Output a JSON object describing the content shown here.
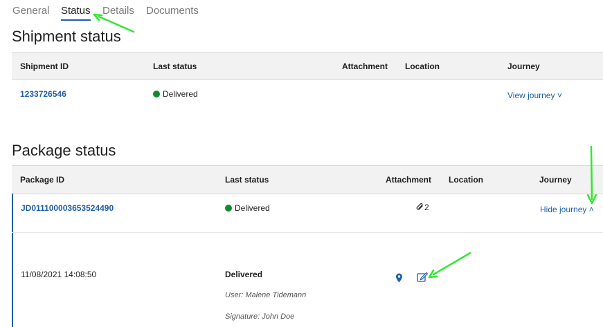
{
  "tabs": [
    {
      "label": "General"
    },
    {
      "label": "Status"
    },
    {
      "label": "Details"
    },
    {
      "label": "Documents"
    }
  ],
  "shipment": {
    "title": "Shipment status",
    "columns": [
      "Shipment ID",
      "Last status",
      "Attachment",
      "Location",
      "Journey"
    ],
    "row": {
      "id": "1233726546",
      "status": "Delivered",
      "journey_link": "View journey",
      "journey_chevron": "˅"
    }
  },
  "package": {
    "title": "Package status",
    "columns": [
      "Package ID",
      "Last status",
      "Attachment",
      "Location",
      "Journey"
    ],
    "row": {
      "id": "JD011100003653524490",
      "status": "Delivered",
      "attachment_count": "2",
      "journey_link": "Hide journey",
      "journey_chevron": "˄"
    },
    "event": {
      "datetime": "11/08/2021 14:08:50",
      "status": "Delivered",
      "user": "User: Malene Tidemann",
      "signature": "Signature: John Doe"
    }
  },
  "colors": {
    "accent": "#1f5ea8",
    "delivered": "#118a2a",
    "annotation": "#2ee82e"
  },
  "icons": {
    "attachment": "paperclip-icon",
    "location": "map-pin-icon",
    "edit": "edit-icon"
  }
}
